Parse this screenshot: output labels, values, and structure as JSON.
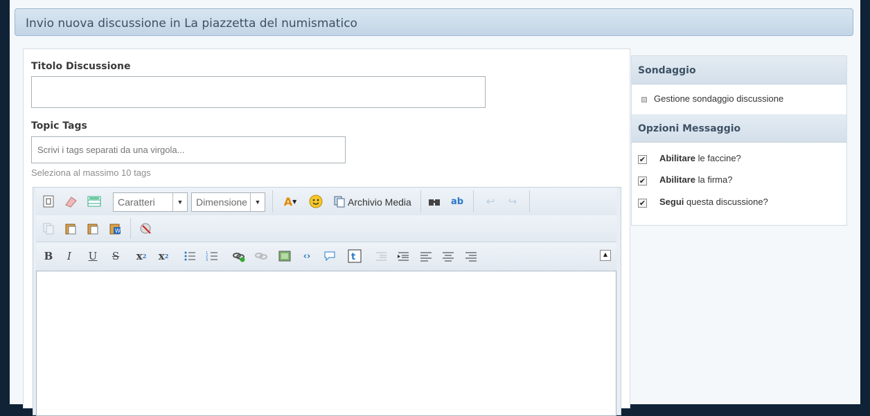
{
  "header": {
    "title": "Invio nuova discussione in La piazzetta del numismatico"
  },
  "form": {
    "title_label": "Titolo Discussione",
    "title_value": "",
    "tags_label": "Topic Tags",
    "tags_placeholder": "Scrivi i tags separati da una virgola...",
    "tags_hint": "Seleziona al massimo 10 tags"
  },
  "editor": {
    "font_select": "Caratteri",
    "size_select": "Dimensione",
    "media_label": "Archivio Media",
    "icons_row1": [
      "source-icon",
      "eraser-icon",
      "table-icon",
      "text-color-icon",
      "smiley-icon",
      "media-icon",
      "binoculars-icon",
      "find-replace-icon",
      "undo-icon",
      "redo-icon"
    ],
    "icons_row2": [
      "copy-icon",
      "paste-icon",
      "paste-text-icon",
      "paste-word-icon",
      "remove-format-icon"
    ],
    "icons_row3": [
      "bold-icon",
      "italic-icon",
      "underline-icon",
      "strike-icon",
      "subscript-icon",
      "superscript-icon",
      "bullet-list-icon",
      "numbered-list-icon",
      "link-icon",
      "unlink-icon",
      "image-icon",
      "code-icon",
      "quote-icon",
      "twitter-icon",
      "outdent-icon",
      "indent-icon",
      "align-left-icon",
      "align-center-icon",
      "align-right-icon"
    ]
  },
  "sidebar": {
    "poll_title": "Sondaggio",
    "poll_item": "Gestione sondaggio discussione",
    "options_title": "Opzioni Messaggio",
    "options": [
      {
        "bold": "Abilitare",
        "rest": " le faccine?",
        "checked": true
      },
      {
        "bold": "Abilitare",
        "rest": " la firma?",
        "checked": true
      },
      {
        "bold": "Segui",
        "rest": " questa discussione?",
        "checked": true
      }
    ]
  }
}
